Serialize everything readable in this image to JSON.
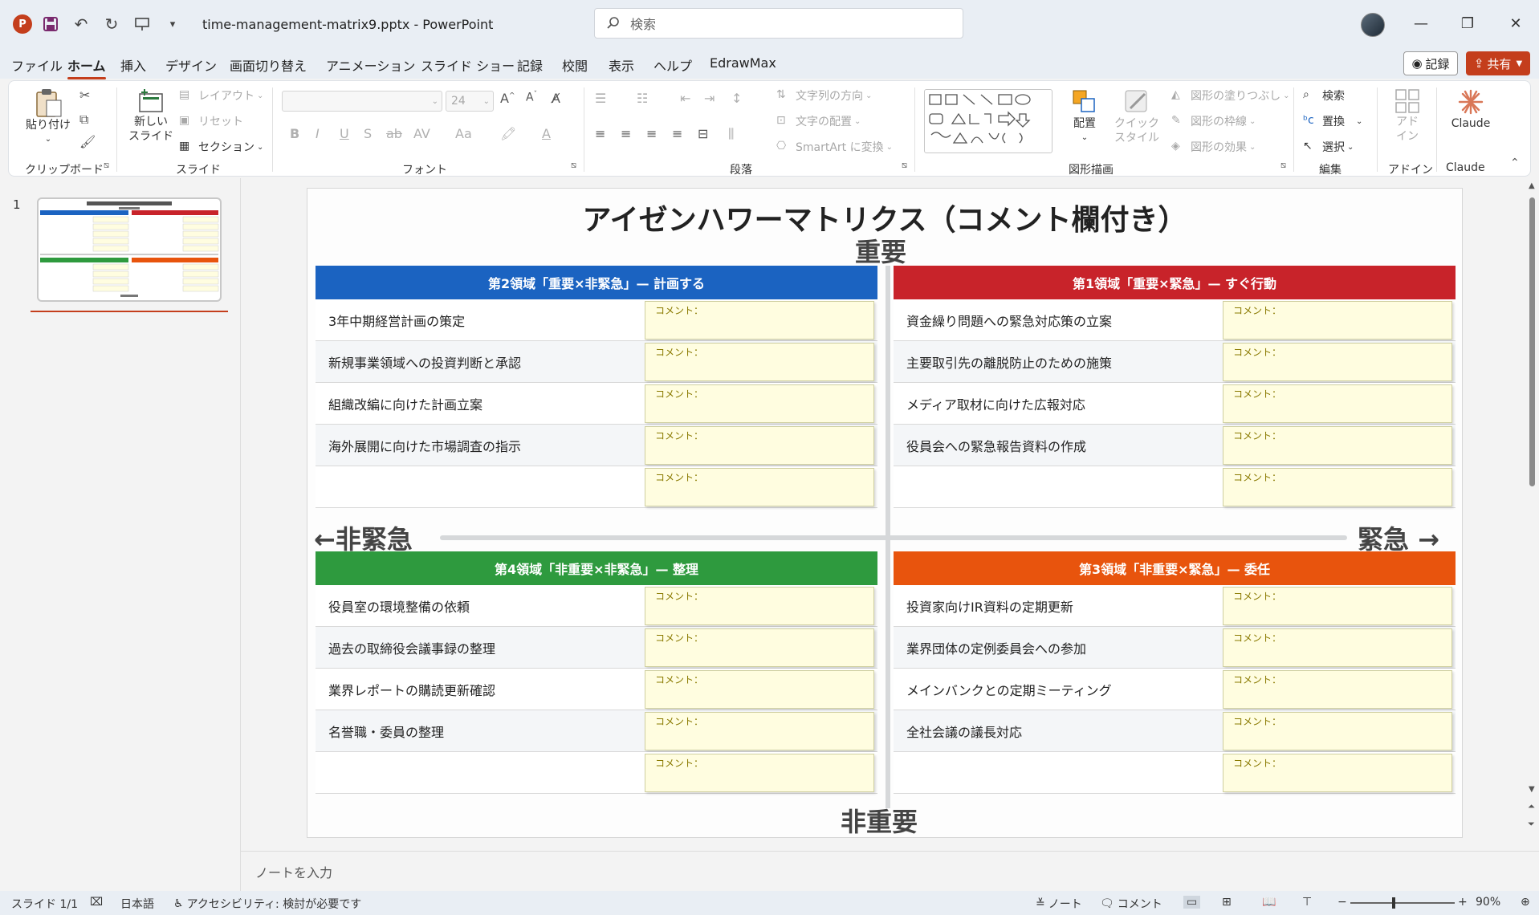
{
  "app": {
    "file_title": "time-management-matrix9.pptx  -  PowerPoint",
    "search_placeholder": "検索"
  },
  "menu": {
    "tabs": [
      "ファイル",
      "ホーム",
      "挿入",
      "デザイン",
      "画面切り替え",
      "アニメーション",
      "スライド ショー",
      "記録",
      "校閲",
      "表示",
      "ヘルプ",
      "EdrawMax"
    ],
    "active": "ホーム",
    "record_label": "記録",
    "share_label": "共有"
  },
  "ribbon": {
    "groups": {
      "clipboard": "クリップボード",
      "slides": "スライド",
      "font": "フォント",
      "paragraph": "段落",
      "drawing": "図形描画",
      "editing": "編集",
      "addins": "アドイン",
      "claude": "Claude"
    },
    "paste": "貼り付け",
    "new_slide": "新しい\nスライド",
    "layout": "レイアウト",
    "reset": "リセット",
    "section": "セクション",
    "font_size": "24",
    "text_direction": "文字列の方向",
    "text_align": "文字の配置",
    "smartart": "SmartArt に変換",
    "arrange": "配置",
    "quick_style": "クイック\nスタイル",
    "shape_fill": "図形の塗りつぶし",
    "shape_outline": "図形の枠線",
    "shape_effect": "図形の効果",
    "find": "検索",
    "replace": "置換",
    "select": "選択",
    "addin": "アド\nイン",
    "claude_btn": "Claude"
  },
  "thumbnails": {
    "slide_number": "1"
  },
  "slide": {
    "title": "アイゼンハワーマトリクス（コメント欄付き）",
    "axis_top": "重要",
    "axis_bottom": "非重要",
    "axis_left": "←非緊急",
    "axis_right": "緊急 →",
    "comment_label": "コメント：",
    "q2": {
      "header": "第2領域「重要×非緊急」— 計画する",
      "color": "#1b63c1",
      "tasks": [
        "3年中期経営計画の策定",
        "新規事業領域への投資判断と承認",
        "組織改編に向けた計画立案",
        "海外展開に向けた市場調査の指示",
        ""
      ]
    },
    "q1": {
      "header": "第1領域「重要×緊急」— すぐ行動",
      "color": "#c8232a",
      "tasks": [
        "資金繰り問題への緊急対応策の立案",
        "主要取引先の離脱防止のための施策",
        "メディア取材に向けた広報対応",
        "役員会への緊急報告資料の作成",
        ""
      ]
    },
    "q4": {
      "header": "第4領域「非重要×非緊急」— 整理",
      "color": "#2e9a3e",
      "tasks": [
        "役員室の環境整備の依頼",
        "過去の取締役会議事録の整理",
        "業界レポートの購読更新確認",
        "名誉職・委員の整理",
        ""
      ]
    },
    "q3": {
      "header": "第3領域「非重要×緊急」— 委任",
      "color": "#e8540d",
      "tasks": [
        "投資家向けIR資料の定期更新",
        "業界団体の定例委員会への参加",
        "メインバンクとの定期ミーティング",
        "全社会議の議長対応",
        ""
      ]
    }
  },
  "notes_placeholder": "ノートを入力",
  "status": {
    "slide": "スライド 1/1",
    "language": "日本語",
    "accessibility": "アクセシビリティ: 検討が必要です",
    "notes": "ノート",
    "comments": "コメント",
    "zoom": "90%"
  }
}
